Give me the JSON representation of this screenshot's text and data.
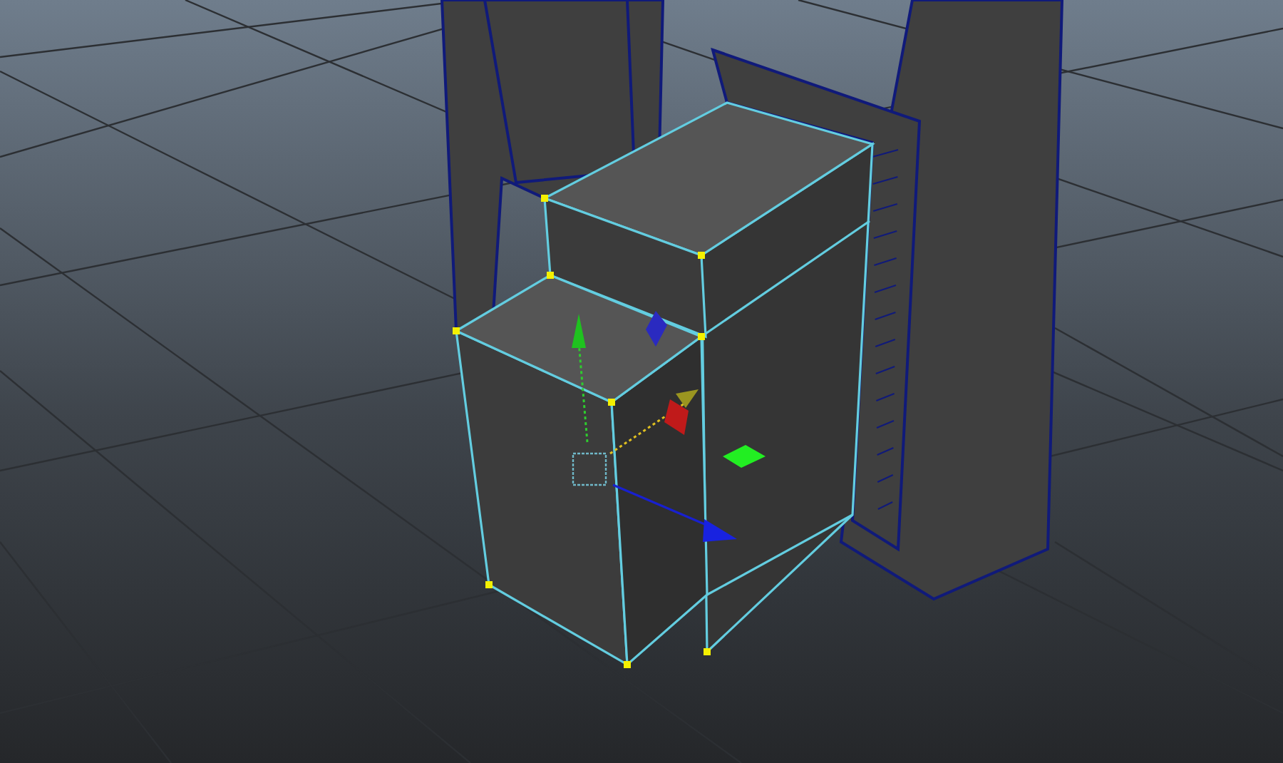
{
  "viewport": {
    "grid": true,
    "selection": {
      "kind": "mesh",
      "vertices_shown": true
    },
    "manipulator": {
      "kind": "move"
    }
  }
}
